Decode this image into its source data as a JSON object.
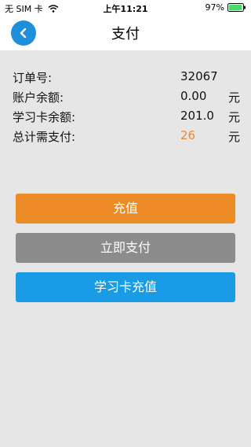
{
  "status_bar": {
    "carrier": "无 SIM 卡",
    "time": "上午11:21",
    "battery": "97%",
    "battery_level": 0.97
  },
  "nav": {
    "title": "支付",
    "back_icon": "chevron-left-icon"
  },
  "order": {
    "rows": [
      {
        "label": "订单号:",
        "value": "32067",
        "unit": ""
      },
      {
        "label": "账户余额:",
        "value": "0.00",
        "unit": "元"
      },
      {
        "label": "学习卡余额:",
        "value": "201.0",
        "unit": "元"
      },
      {
        "label": "总计需支付:",
        "value": "26",
        "unit": "元"
      }
    ]
  },
  "buttons": {
    "recharge": "充值",
    "pay_now": "立即支付",
    "card_recharge": "学习卡充值"
  },
  "colors": {
    "accent_orange": "#ed8b26",
    "accent_blue": "#1a9be6",
    "gray": "#8c8c8c",
    "total_highlight": "#f0862a"
  }
}
